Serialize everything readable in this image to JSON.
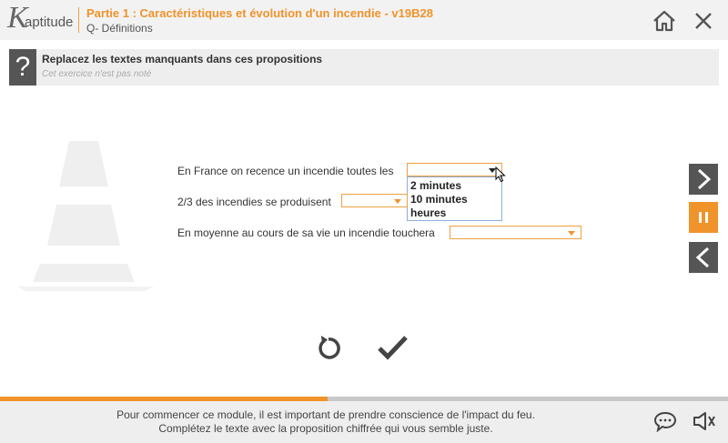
{
  "header": {
    "logo_k": "K",
    "logo_text": "aptitude",
    "title": "Partie 1 : Caractéristiques et évolution d'un incendie - v19B28",
    "subtitle": "Q- Définitions",
    "home_icon": "home-icon",
    "close_icon": "close-icon"
  },
  "question": {
    "icon_text": "?",
    "title": "Replacez les textes manquants dans ces propositions",
    "note": "Cet exercice n'est pas noté"
  },
  "sentences": [
    {
      "text": "En France on recence un incendie toutes les",
      "selected": ""
    },
    {
      "text": "2/3 des incendies se produisent",
      "selected": ""
    },
    {
      "text": "En moyenne au cours de sa vie un incendie touchera",
      "selected": ""
    }
  ],
  "dropdown": {
    "options": [
      "2 minutes",
      "10 minutes",
      "heures"
    ]
  },
  "side_nav": {
    "next_icon": "chevron-right-icon",
    "pause_icon": "pause-icon",
    "prev_icon": "chevron-left-icon"
  },
  "actions": {
    "reset_icon": "reset-icon",
    "validate_icon": "checkmark-icon"
  },
  "progress": {
    "value": 0.45
  },
  "footer": {
    "line1": "Pour commencer ce module, il est important de prendre conscience de l'impact du feu.",
    "line2": "Complétez le texte avec la proposition chiffrée qui vous semble juste.",
    "chat_icon": "chat-icon",
    "sound_icon": "speaker-icon"
  },
  "colors": {
    "accent": "#f0932b",
    "dark": "#555555",
    "band": "#eeeeee"
  }
}
